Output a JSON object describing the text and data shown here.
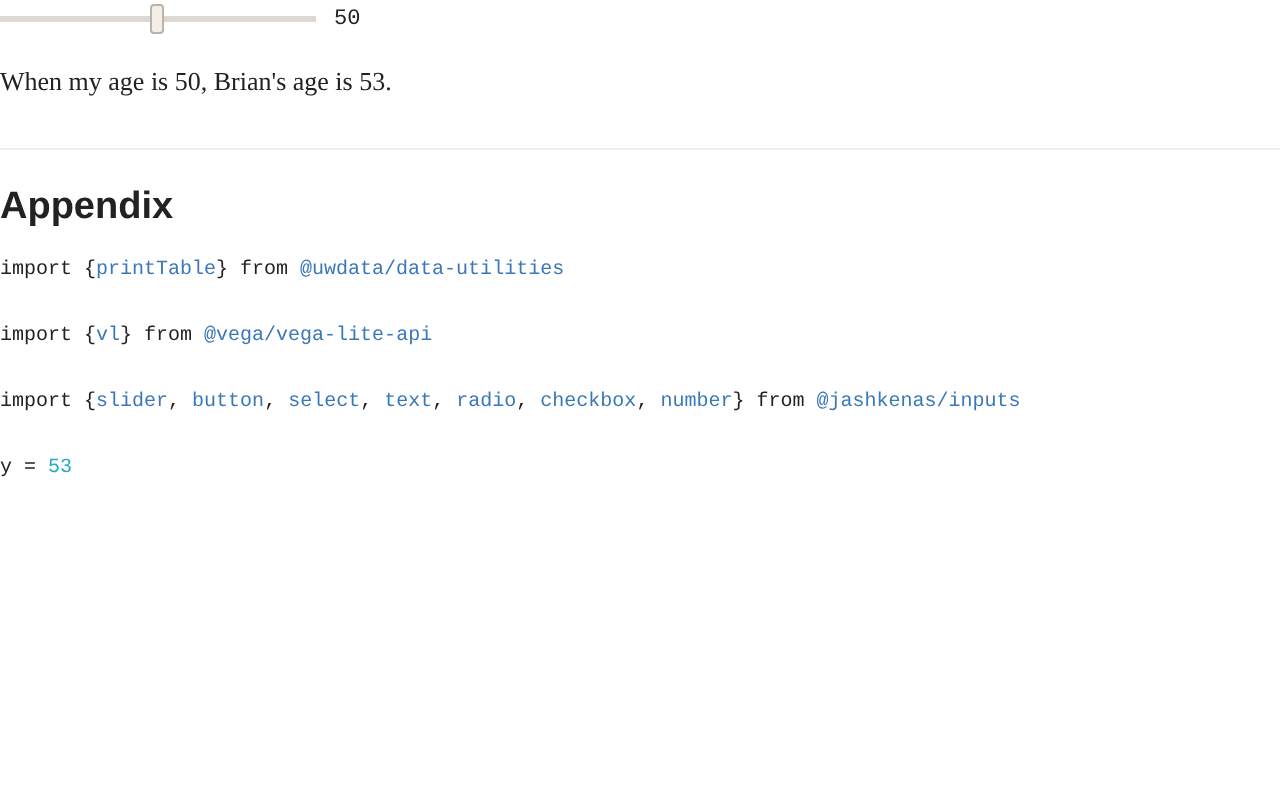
{
  "slider": {
    "level": 0.5,
    "reading": "50"
  },
  "sentence": "When my age is 50, Brian's age is 53.",
  "heading": "Appendix",
  "code_lines": [
    [
      {
        "kind": "plain",
        "text": "import {"
      },
      {
        "kind": "name",
        "text": "printTable"
      },
      {
        "kind": "plain",
        "text": "} from "
      },
      {
        "kind": "module",
        "text": "@uwdata/data-utilities"
      }
    ],
    [
      {
        "kind": "plain",
        "text": "import {"
      },
      {
        "kind": "name",
        "text": "vl"
      },
      {
        "kind": "plain",
        "text": "} from "
      },
      {
        "kind": "module",
        "text": "@vega/vega-lite-api"
      }
    ],
    [
      {
        "kind": "plain",
        "text": "import {"
      },
      {
        "kind": "name",
        "text": "slider"
      },
      {
        "kind": "plain",
        "text": ", "
      },
      {
        "kind": "name",
        "text": "button"
      },
      {
        "kind": "plain",
        "text": ", "
      },
      {
        "kind": "name",
        "text": "select"
      },
      {
        "kind": "plain",
        "text": ", "
      },
      {
        "kind": "name",
        "text": "text"
      },
      {
        "kind": "plain",
        "text": ", "
      },
      {
        "kind": "name",
        "text": "radio"
      },
      {
        "kind": "plain",
        "text": ", "
      },
      {
        "kind": "name",
        "text": "checkbox"
      },
      {
        "kind": "plain",
        "text": ", "
      },
      {
        "kind": "name",
        "text": "number"
      },
      {
        "kind": "plain",
        "text": "} from "
      },
      {
        "kind": "module",
        "text": "@jashkenas/inputs"
      }
    ],
    [
      {
        "kind": "plain",
        "text": "y = "
      },
      {
        "kind": "number",
        "text": "53"
      }
    ]
  ]
}
